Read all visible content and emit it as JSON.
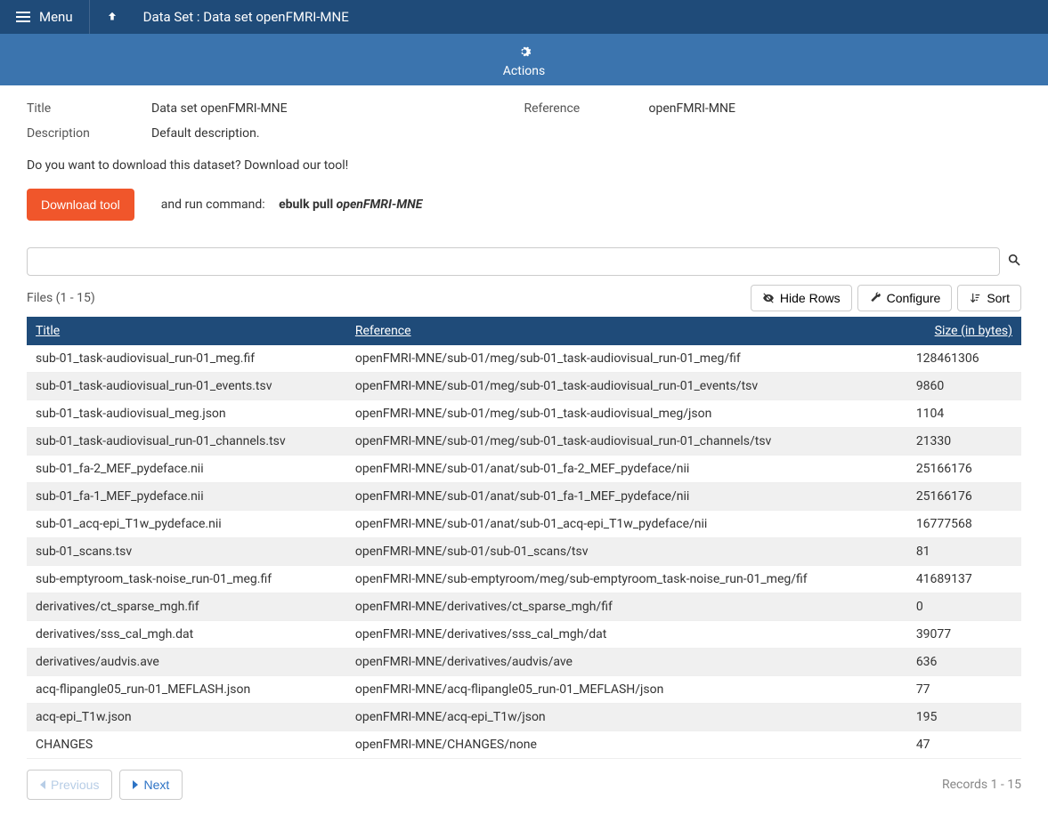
{
  "topbar": {
    "menu_label": "Menu",
    "breadcrumb": "Data Set : Data set openFMRI-MNE"
  },
  "actions_bar": {
    "label": "Actions"
  },
  "meta": {
    "title_label": "Title",
    "title_value": "Data set openFMRI-MNE",
    "reference_label": "Reference",
    "reference_value": "openFMRI-MNE",
    "description_label": "Description",
    "description_value": "Default description."
  },
  "download": {
    "note": "Do you want to download this dataset? Download our tool!",
    "button": "Download tool",
    "run_label": "and run command:",
    "cmd_prefix": "ebulk pull",
    "cmd_arg": "openFMRI-MNE"
  },
  "search": {
    "value": ""
  },
  "toolbar": {
    "files_label": "Files (1 - 15)",
    "hide_rows": "Hide Rows",
    "configure": "Configure",
    "sort": "Sort"
  },
  "table": {
    "headers": {
      "title": "Title",
      "reference": "Reference",
      "size": "Size (in bytes)"
    },
    "rows": [
      {
        "title": "sub-01_task-audiovisual_run-01_meg.fif",
        "reference": "openFMRI-MNE/sub-01/meg/sub-01_task-audiovisual_run-01_meg/fif",
        "size": "128461306"
      },
      {
        "title": "sub-01_task-audiovisual_run-01_events.tsv",
        "reference": "openFMRI-MNE/sub-01/meg/sub-01_task-audiovisual_run-01_events/tsv",
        "size": "9860"
      },
      {
        "title": "sub-01_task-audiovisual_meg.json",
        "reference": "openFMRI-MNE/sub-01/meg/sub-01_task-audiovisual_meg/json",
        "size": "1104"
      },
      {
        "title": "sub-01_task-audiovisual_run-01_channels.tsv",
        "reference": "openFMRI-MNE/sub-01/meg/sub-01_task-audiovisual_run-01_channels/tsv",
        "size": "21330"
      },
      {
        "title": "sub-01_fa-2_MEF_pydeface.nii",
        "reference": "openFMRI-MNE/sub-01/anat/sub-01_fa-2_MEF_pydeface/nii",
        "size": "25166176"
      },
      {
        "title": "sub-01_fa-1_MEF_pydeface.nii",
        "reference": "openFMRI-MNE/sub-01/anat/sub-01_fa-1_MEF_pydeface/nii",
        "size": "25166176"
      },
      {
        "title": "sub-01_acq-epi_T1w_pydeface.nii",
        "reference": "openFMRI-MNE/sub-01/anat/sub-01_acq-epi_T1w_pydeface/nii",
        "size": "16777568"
      },
      {
        "title": "sub-01_scans.tsv",
        "reference": "openFMRI-MNE/sub-01/sub-01_scans/tsv",
        "size": "81"
      },
      {
        "title": "sub-emptyroom_task-noise_run-01_meg.fif",
        "reference": "openFMRI-MNE/sub-emptyroom/meg/sub-emptyroom_task-noise_run-01_meg/fif",
        "size": "41689137"
      },
      {
        "title": "derivatives/ct_sparse_mgh.fif",
        "reference": "openFMRI-MNE/derivatives/ct_sparse_mgh/fif",
        "size": "0"
      },
      {
        "title": "derivatives/sss_cal_mgh.dat",
        "reference": "openFMRI-MNE/derivatives/sss_cal_mgh/dat",
        "size": "39077"
      },
      {
        "title": "derivatives/audvis.ave",
        "reference": "openFMRI-MNE/derivatives/audvis/ave",
        "size": "636"
      },
      {
        "title": "acq-flipangle05_run-01_MEFLASH.json",
        "reference": "openFMRI-MNE/acq-flipangle05_run-01_MEFLASH/json",
        "size": "77"
      },
      {
        "title": "acq-epi_T1w.json",
        "reference": "openFMRI-MNE/acq-epi_T1w/json",
        "size": "195"
      },
      {
        "title": "CHANGES",
        "reference": "openFMRI-MNE/CHANGES/none",
        "size": "47"
      }
    ]
  },
  "pagination": {
    "previous": "Previous",
    "next": "Next",
    "records": "Records 1 - 15"
  }
}
